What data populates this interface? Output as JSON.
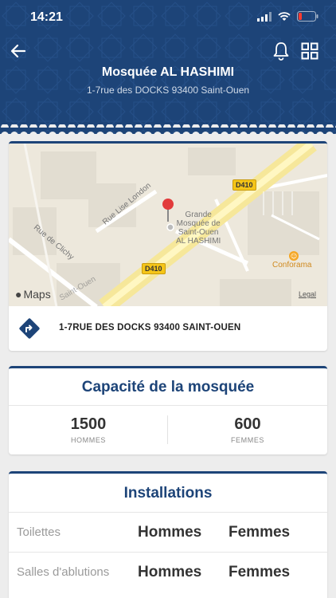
{
  "status_bar": {
    "time": "14:21"
  },
  "header": {
    "title": "Mosquée AL HASHIMI",
    "subtitle": "1-7rue des DOCKS 93400 Saint-Ouen",
    "back_icon": "arrow-left-icon",
    "notification_icon": "bell-icon",
    "grid_icon": "grid-icon"
  },
  "map": {
    "road_badges": [
      "D410",
      "D410"
    ],
    "street_labels": [
      "Rue Lise London",
      "Rue de Clichy",
      "Saint-Ouen"
    ],
    "poi_lines": [
      "Grande",
      "Mosquée de",
      "Saint-Ouen",
      "AL HASHIMI"
    ],
    "store_label": "Conforama",
    "brand": "Maps",
    "legal": "Legal"
  },
  "address": {
    "text": "1-7RUE DES DOCKS 93400 SAINT-OUEN",
    "icon": "directions-icon"
  },
  "capacity": {
    "title": "Capacité de la mosquée",
    "men_count": "1500",
    "men_label": "HOMMES",
    "women_count": "600",
    "women_label": "FEMMES"
  },
  "installations": {
    "title": "Installations",
    "rows": [
      {
        "label": "Toilettes",
        "men": "Hommes",
        "women": "Femmes"
      },
      {
        "label": "Salles d'ablutions",
        "men": "Hommes",
        "women": "Femmes"
      }
    ]
  },
  "colors": {
    "primary": "#1d4478",
    "background": "#ededed",
    "road": "#f6e79a"
  }
}
